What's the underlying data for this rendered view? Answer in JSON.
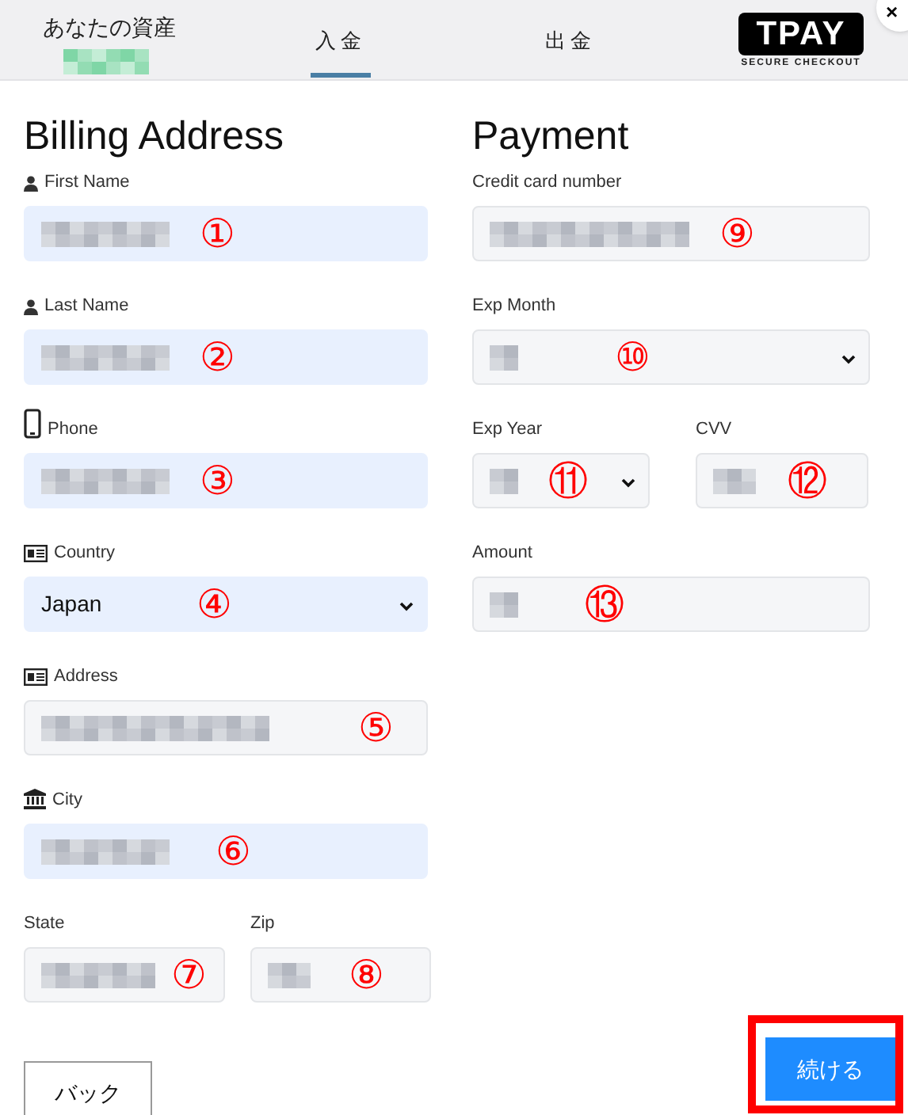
{
  "header": {
    "assets_label": "あなたの資産",
    "assets_blurred": true,
    "tabs": [
      {
        "label": "入金",
        "selected": true
      },
      {
        "label": "出金",
        "selected": false
      }
    ],
    "logo": {
      "name": "TPAY",
      "tagline": "SECURE CHECKOUT"
    },
    "close": "×"
  },
  "billing": {
    "title": "Billing Address",
    "fields": [
      {
        "label": "First Name",
        "kind": "input",
        "autofilled": true,
        "marker": "①",
        "blurred": true
      },
      {
        "label": "Last Name",
        "kind": "input",
        "autofilled": true,
        "marker": "②",
        "blurred": true
      },
      {
        "label": "Phone",
        "kind": "input",
        "autofilled": true,
        "marker": "③",
        "blurred": true
      },
      {
        "label": "Country",
        "kind": "select",
        "autofilled": true,
        "marker": "④",
        "value": "Japan"
      },
      {
        "label": "Address",
        "kind": "input",
        "autofilled": false,
        "marker": "⑤",
        "blurred": true
      },
      {
        "label": "City",
        "kind": "input",
        "autofilled": true,
        "marker": "⑥",
        "blurred": true
      }
    ],
    "pair": [
      {
        "label": "State",
        "kind": "input",
        "autofilled": false,
        "marker": "⑦",
        "blurred": true
      },
      {
        "label": "Zip",
        "kind": "input",
        "autofilled": false,
        "marker": "⑧",
        "blurred": true
      }
    ]
  },
  "payment": {
    "title": "Payment",
    "fields": [
      {
        "label": "Credit card number",
        "kind": "input",
        "autofilled": false,
        "marker": "⑨",
        "blurred": true
      },
      {
        "label": "Exp Month",
        "kind": "select",
        "autofilled": false,
        "marker": "⑩",
        "blurred": true
      }
    ],
    "pair": [
      {
        "label": "Exp Year",
        "kind": "select",
        "autofilled": false,
        "marker": "⑪",
        "blurred": true
      },
      {
        "label": "CVV",
        "kind": "input",
        "autofilled": false,
        "marker": "⑫",
        "blurred": true
      }
    ],
    "after": [
      {
        "label": "Amount",
        "kind": "input",
        "autofilled": false,
        "marker": "⑬",
        "blurred": true
      }
    ]
  },
  "buttons": {
    "back": "バック",
    "continue": "続ける",
    "continue_highlighted": true
  }
}
